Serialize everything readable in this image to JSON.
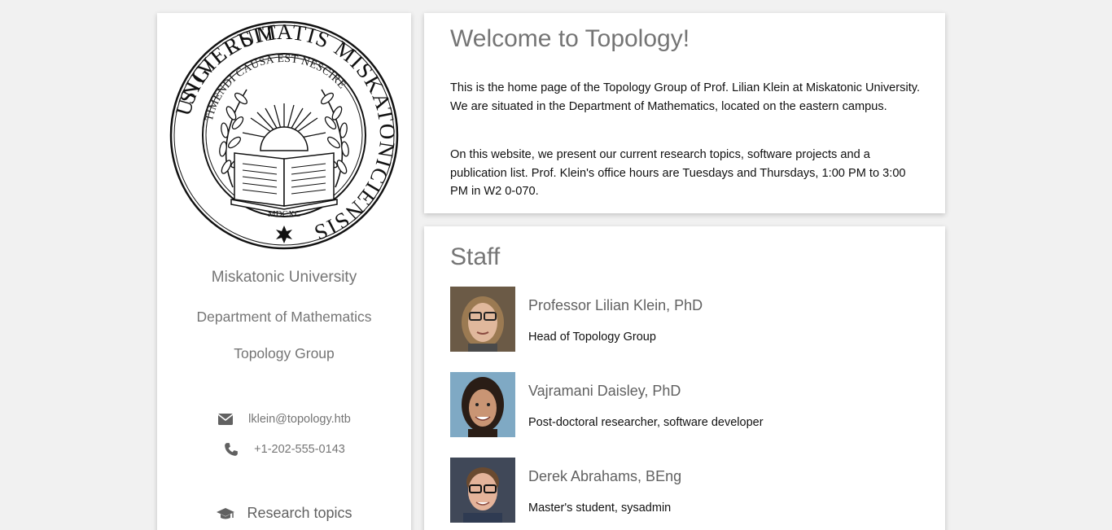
{
  "sidebar": {
    "seal": {
      "outer_text": "UNIVERSITATIS MISKATONICIENSIS SIGILLUM",
      "inner_text": "TIMENDI CAUSA EST NESCIRE",
      "year": "MDCXC"
    },
    "university": "Miskatonic University",
    "department": "Department of Mathematics",
    "group": "Topology Group",
    "email": "lklein@topology.htb",
    "phone": "+1-202-555-0143",
    "nav": [
      {
        "label": "Research topics",
        "icon": "graduation-cap-icon"
      }
    ]
  },
  "welcome": {
    "title": "Welcome to Topology!",
    "paragraphs": [
      "This is the home page of the Topology Group of Prof. Lilian Klein at Miskatonic University. We are situated in the Department of Mathematics, located on the eastern campus.",
      "On this website, we present our current research topics, software projects and a publication list. Prof. Klein's office hours are Tuesdays and Thursdays, 1:00 PM to 3:00 PM in W2 0-070."
    ]
  },
  "staff": {
    "title": "Staff",
    "members": [
      {
        "name": "Professor Lilian Klein, PhD",
        "role": "Head of Topology Group"
      },
      {
        "name": "Vajramani Daisley, PhD",
        "role": "Post-doctoral researcher, software developer"
      },
      {
        "name": "Derek Abrahams, BEng",
        "role": "Master's student, sysadmin"
      }
    ]
  },
  "icons": {
    "email": "envelope-icon",
    "phone": "phone-icon"
  },
  "colors": {
    "background": "#f1f1f1",
    "heading": "#757575",
    "card": "#ffffff"
  }
}
